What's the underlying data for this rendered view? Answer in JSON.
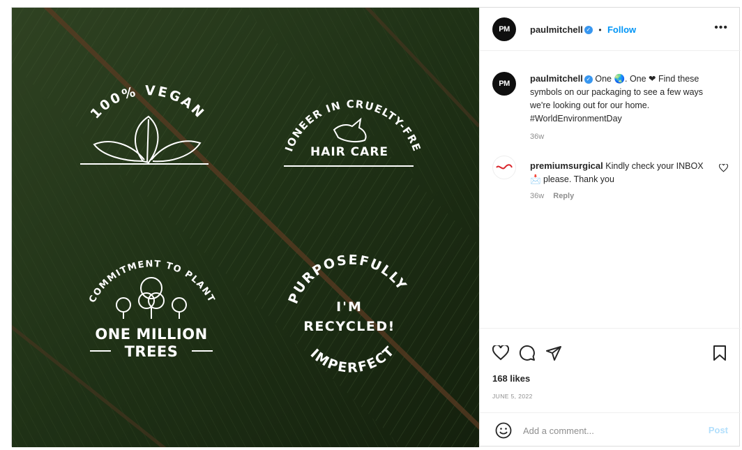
{
  "post": {
    "author": "paulmitchell",
    "avatar_initials": "PM",
    "follow_label": "Follow",
    "dot": "•",
    "more_label": "•••"
  },
  "image": {
    "badges": {
      "vegan": "100% VEGAN",
      "cruelty_arc": "PIONEER IN CRUELTY-FREE",
      "cruelty_main": "HAIR CARE",
      "trees_arc": "COMMITMENT TO PLANT",
      "trees_line1": "ONE MILLION",
      "trees_line2": "TREES",
      "recycled_arc_top": "PURPOSEFULLY",
      "recycled_line1": "I'M",
      "recycled_line2": "RECYCLED!",
      "recycled_arc_bottom": "IMPERFECT"
    }
  },
  "comments": [
    {
      "user": "paulmitchell",
      "avatar_initials": "PM",
      "caption_line1": "One 🌏. One ❤",
      "caption_rest": "Find these symbols on our packaging to see a few ways we're looking out for our home. #WorldEnvironmentDay",
      "time": "36w"
    },
    {
      "user": "premiumsurgical",
      "text": "Kindly check your INBOX 📩 please. Thank you",
      "time": "36w",
      "reply_label": "Reply"
    }
  ],
  "likes": "168 likes",
  "date": "JUNE 5, 2022",
  "add_comment": {
    "placeholder": "Add a comment...",
    "post_label": "Post"
  },
  "icons": [
    "like-icon",
    "comment-icon",
    "share-icon",
    "save-icon",
    "emoji-icon",
    "more-icon",
    "verified-icon",
    "comment-like-icon"
  ],
  "colors": {
    "accent": "#0095f6",
    "post_disabled": "#b2dffc",
    "leaf_dark": "#17240f",
    "text_gray": "#8e8e8e"
  }
}
